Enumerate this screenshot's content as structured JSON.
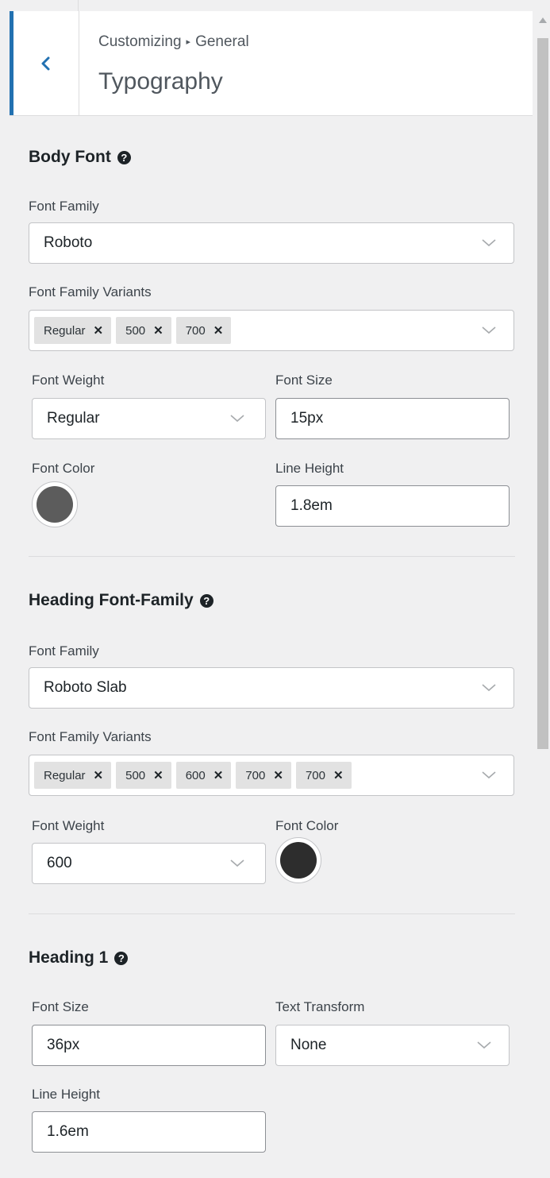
{
  "header": {
    "breadcrumb_root": "Customizing",
    "breadcrumb_section": "General",
    "title": "Typography"
  },
  "body_font": {
    "title": "Body Font",
    "help": "?",
    "font_family_label": "Font Family",
    "font_family_value": "Roboto",
    "variants_label": "Font Family Variants",
    "variants": [
      "Regular",
      "500",
      "700"
    ],
    "font_weight_label": "Font Weight",
    "font_weight_value": "Regular",
    "font_size_label": "Font Size",
    "font_size_value": "15px",
    "font_color_label": "Font Color",
    "font_color": "#5c5c5c",
    "line_height_label": "Line Height",
    "line_height_value": "1.8em"
  },
  "heading_font": {
    "title": "Heading Font-Family",
    "help": "?",
    "font_family_label": "Font Family",
    "font_family_value": "Roboto Slab",
    "variants_label": "Font Family Variants",
    "variants": [
      "Regular",
      "500",
      "600",
      "700",
      "700"
    ],
    "font_weight_label": "Font Weight",
    "font_weight_value": "600",
    "font_color_label": "Font Color",
    "font_color": "#2d2d2d"
  },
  "heading1": {
    "title": "Heading 1",
    "help": "?",
    "font_size_label": "Font Size",
    "font_size_value": "36px",
    "text_transform_label": "Text Transform",
    "text_transform_value": "None",
    "line_height_label": "Line Height",
    "line_height_value": "1.6em"
  },
  "icons": {
    "back": "chevron-left-icon",
    "dropdown": "chevron-down-icon",
    "remove": "close-icon",
    "help": "question-circle-icon"
  },
  "colors": {
    "accent": "#2271b1"
  }
}
